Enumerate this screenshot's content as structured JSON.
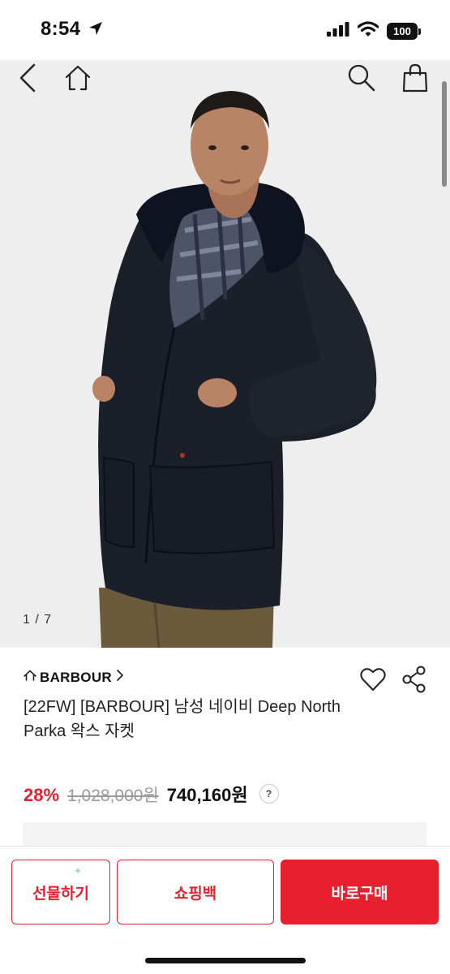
{
  "status_bar": {
    "time": "8:54",
    "battery": "100"
  },
  "nav": {
    "back_icon": "chevron-left-icon",
    "home_icon": "home-icon",
    "search_icon": "search-icon",
    "bag_icon": "shopping-bag-icon"
  },
  "gallery": {
    "page_indicator": "1 / 7"
  },
  "product": {
    "brand": "BARBOUR",
    "title": "[22FW] [BARBOUR] 남성 네이비 Deep North Parka 왁스 자켓",
    "discount": "28%",
    "original_price": "1,028,000원",
    "final_price": "740,160원",
    "help": "?"
  },
  "actions": {
    "gift": "선물하기",
    "shopping_bag": "쇼핑백",
    "buy_now": "바로구매"
  },
  "colors": {
    "accent": "#e8202e",
    "strike": "#9a9a9a"
  }
}
